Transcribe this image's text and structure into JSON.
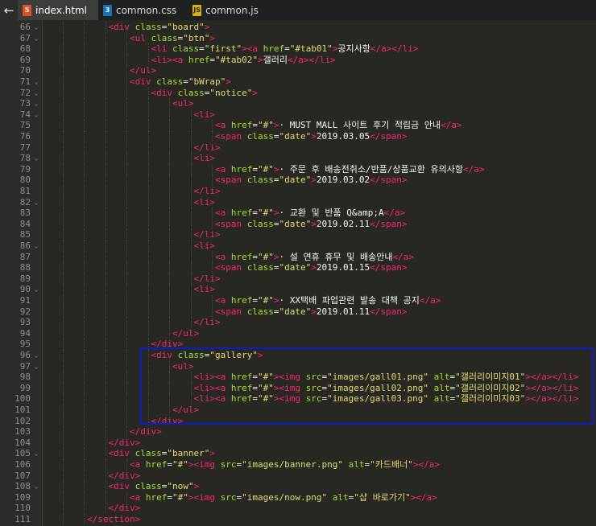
{
  "tabs": [
    {
      "label": "index.html",
      "icon": "html5-icon",
      "badge": "5",
      "color": "#e44d26",
      "active": true
    },
    {
      "label": "common.css",
      "icon": "css3-icon",
      "badge": "3",
      "color": "#1572b6",
      "active": false
    },
    {
      "label": "common.js",
      "icon": "js-icon",
      "badge": "JS",
      "color": "#d6b400",
      "active": false
    }
  ],
  "highlight_color": "#0a1bd6",
  "lines": [
    {
      "n": "66",
      "fold": "⌄",
      "indent": 3,
      "tokens": [
        [
          "tg",
          "<div"
        ],
        [
          "tx",
          " "
        ],
        [
          "at",
          "class"
        ],
        [
          "tx",
          "="
        ],
        [
          "st",
          "\"board\""
        ],
        [
          "tg",
          ">"
        ]
      ]
    },
    {
      "n": "67",
      "fold": "⌄",
      "indent": 4,
      "tokens": [
        [
          "tg",
          "<ul"
        ],
        [
          "tx",
          " "
        ],
        [
          "at",
          "class"
        ],
        [
          "tx",
          "="
        ],
        [
          "st",
          "\"btn\""
        ],
        [
          "tg",
          ">"
        ]
      ]
    },
    {
      "n": "68",
      "fold": "",
      "indent": 5,
      "tokens": [
        [
          "tg",
          "<li"
        ],
        [
          "tx",
          " "
        ],
        [
          "at",
          "class"
        ],
        [
          "tx",
          "="
        ],
        [
          "st",
          "\"first\""
        ],
        [
          "tg",
          ">"
        ],
        [
          "tg",
          "<a"
        ],
        [
          "tx",
          " "
        ],
        [
          "at",
          "href"
        ],
        [
          "tx",
          "="
        ],
        [
          "st",
          "\"#tab01\""
        ],
        [
          "tg",
          ">"
        ],
        [
          "tx",
          "공지사항"
        ],
        [
          "tg",
          "</a>"
        ],
        [
          "tg",
          "</li>"
        ]
      ]
    },
    {
      "n": "69",
      "fold": "",
      "indent": 5,
      "tokens": [
        [
          "tg",
          "<li>"
        ],
        [
          "tg",
          "<a"
        ],
        [
          "tx",
          " "
        ],
        [
          "at",
          "href"
        ],
        [
          "tx",
          "="
        ],
        [
          "st",
          "\"#tab02\""
        ],
        [
          "tg",
          ">"
        ],
        [
          "tx",
          "갤러리"
        ],
        [
          "tg",
          "</a>"
        ],
        [
          "tg",
          "</li>"
        ]
      ]
    },
    {
      "n": "70",
      "fold": "",
      "indent": 4,
      "tokens": [
        [
          "tg",
          "</ul>"
        ]
      ]
    },
    {
      "n": "71",
      "fold": "⌄",
      "indent": 4,
      "tokens": [
        [
          "tg",
          "<div"
        ],
        [
          "tx",
          " "
        ],
        [
          "at",
          "class"
        ],
        [
          "tx",
          "="
        ],
        [
          "st",
          "\"bWrap\""
        ],
        [
          "tg",
          ">"
        ]
      ]
    },
    {
      "n": "72",
      "fold": "⌄",
      "indent": 5,
      "tokens": [
        [
          "tg",
          "<div"
        ],
        [
          "tx",
          " "
        ],
        [
          "at",
          "class"
        ],
        [
          "tx",
          "="
        ],
        [
          "st",
          "\"notice\""
        ],
        [
          "tg",
          ">"
        ]
      ]
    },
    {
      "n": "73",
      "fold": "⌄",
      "indent": 6,
      "tokens": [
        [
          "tg",
          "<ul>"
        ]
      ]
    },
    {
      "n": "74",
      "fold": "⌄",
      "indent": 7,
      "tokens": [
        [
          "tg",
          "<li>"
        ]
      ]
    },
    {
      "n": "75",
      "fold": "",
      "indent": 8,
      "tokens": [
        [
          "tg",
          "<a"
        ],
        [
          "tx",
          " "
        ],
        [
          "at",
          "href"
        ],
        [
          "tx",
          "="
        ],
        [
          "st",
          "\"#\""
        ],
        [
          "tg",
          ">"
        ],
        [
          "tx",
          "· MUST MALL 사이트 후기 적립금 안내"
        ],
        [
          "tg",
          "</a>"
        ]
      ]
    },
    {
      "n": "76",
      "fold": "",
      "indent": 8,
      "tokens": [
        [
          "tg",
          "<span"
        ],
        [
          "tx",
          " "
        ],
        [
          "at",
          "class"
        ],
        [
          "tx",
          "="
        ],
        [
          "st",
          "\"date\""
        ],
        [
          "tg",
          ">"
        ],
        [
          "tx",
          "2019.03.05"
        ],
        [
          "tg",
          "</span>"
        ]
      ]
    },
    {
      "n": "77",
      "fold": "",
      "indent": 7,
      "tokens": [
        [
          "tg",
          "</li>"
        ]
      ]
    },
    {
      "n": "78",
      "fold": "⌄",
      "indent": 7,
      "tokens": [
        [
          "tg",
          "<li>"
        ]
      ]
    },
    {
      "n": "79",
      "fold": "",
      "indent": 8,
      "tokens": [
        [
          "tg",
          "<a"
        ],
        [
          "tx",
          " "
        ],
        [
          "at",
          "href"
        ],
        [
          "tx",
          "="
        ],
        [
          "st",
          "\"#\""
        ],
        [
          "tg",
          ">"
        ],
        [
          "tx",
          "· 주문 후 배송전취소/반품/상품교환 유의사항"
        ],
        [
          "tg",
          "</a>"
        ]
      ]
    },
    {
      "n": "80",
      "fold": "",
      "indent": 8,
      "tokens": [
        [
          "tg",
          "<span"
        ],
        [
          "tx",
          " "
        ],
        [
          "at",
          "class"
        ],
        [
          "tx",
          "="
        ],
        [
          "st",
          "\"date\""
        ],
        [
          "tg",
          ">"
        ],
        [
          "tx",
          "2019.03.02"
        ],
        [
          "tg",
          "</span>"
        ]
      ]
    },
    {
      "n": "81",
      "fold": "",
      "indent": 7,
      "tokens": [
        [
          "tg",
          "</li>"
        ]
      ]
    },
    {
      "n": "82",
      "fold": "⌄",
      "indent": 7,
      "tokens": [
        [
          "tg",
          "<li>"
        ]
      ]
    },
    {
      "n": "83",
      "fold": "",
      "indent": 8,
      "tokens": [
        [
          "tg",
          "<a"
        ],
        [
          "tx",
          " "
        ],
        [
          "at",
          "href"
        ],
        [
          "tx",
          "="
        ],
        [
          "st",
          "\"#\""
        ],
        [
          "tg",
          ">"
        ],
        [
          "tx",
          "· 교환 및 반품 Q&amp;A"
        ],
        [
          "tg",
          "</a>"
        ]
      ]
    },
    {
      "n": "84",
      "fold": "",
      "indent": 8,
      "tokens": [
        [
          "tg",
          "<span"
        ],
        [
          "tx",
          " "
        ],
        [
          "at",
          "class"
        ],
        [
          "tx",
          "="
        ],
        [
          "st",
          "\"date\""
        ],
        [
          "tg",
          ">"
        ],
        [
          "tx",
          "2019.02.11"
        ],
        [
          "tg",
          "</span>"
        ]
      ]
    },
    {
      "n": "85",
      "fold": "",
      "indent": 7,
      "tokens": [
        [
          "tg",
          "</li>"
        ]
      ]
    },
    {
      "n": "86",
      "fold": "⌄",
      "indent": 7,
      "tokens": [
        [
          "tg",
          "<li>"
        ]
      ]
    },
    {
      "n": "87",
      "fold": "",
      "indent": 8,
      "tokens": [
        [
          "tg",
          "<a"
        ],
        [
          "tx",
          " "
        ],
        [
          "at",
          "href"
        ],
        [
          "tx",
          "="
        ],
        [
          "st",
          "\"#\""
        ],
        [
          "tg",
          ">"
        ],
        [
          "tx",
          "· 설 연휴 휴무 및 배송안내"
        ],
        [
          "tg",
          "</a>"
        ]
      ]
    },
    {
      "n": "88",
      "fold": "",
      "indent": 8,
      "tokens": [
        [
          "tg",
          "<span"
        ],
        [
          "tx",
          " "
        ],
        [
          "at",
          "class"
        ],
        [
          "tx",
          "="
        ],
        [
          "st",
          "\"date\""
        ],
        [
          "tg",
          ">"
        ],
        [
          "tx",
          "2019.01.15"
        ],
        [
          "tg",
          "</span>"
        ]
      ]
    },
    {
      "n": "89",
      "fold": "",
      "indent": 7,
      "tokens": [
        [
          "tg",
          "</li>"
        ]
      ]
    },
    {
      "n": "90",
      "fold": "⌄",
      "indent": 7,
      "tokens": [
        [
          "tg",
          "<li>"
        ]
      ]
    },
    {
      "n": "91",
      "fold": "",
      "indent": 8,
      "tokens": [
        [
          "tg",
          "<a"
        ],
        [
          "tx",
          " "
        ],
        [
          "at",
          "href"
        ],
        [
          "tx",
          "="
        ],
        [
          "st",
          "\"#\""
        ],
        [
          "tg",
          ">"
        ],
        [
          "tx",
          "· XX택배 파업관련 발송 대책 공지"
        ],
        [
          "tg",
          "</a>"
        ]
      ]
    },
    {
      "n": "92",
      "fold": "",
      "indent": 8,
      "tokens": [
        [
          "tg",
          "<span"
        ],
        [
          "tx",
          " "
        ],
        [
          "at",
          "class"
        ],
        [
          "tx",
          "="
        ],
        [
          "st",
          "\"date\""
        ],
        [
          "tg",
          ">"
        ],
        [
          "tx",
          "2019.01.11"
        ],
        [
          "tg",
          "</span>"
        ]
      ]
    },
    {
      "n": "93",
      "fold": "",
      "indent": 7,
      "tokens": [
        [
          "tg",
          "</li>"
        ]
      ]
    },
    {
      "n": "94",
      "fold": "",
      "indent": 6,
      "tokens": [
        [
          "tg",
          "</ul>"
        ]
      ]
    },
    {
      "n": "95",
      "fold": "",
      "indent": 5,
      "tokens": [
        [
          "tg",
          "</div>"
        ]
      ]
    },
    {
      "n": "96",
      "fold": "⌄",
      "indent": 5,
      "tokens": [
        [
          "tg",
          "<div"
        ],
        [
          "tx",
          " "
        ],
        [
          "at",
          "class"
        ],
        [
          "tx",
          "="
        ],
        [
          "st",
          "\"gallery\""
        ],
        [
          "tg",
          ">"
        ]
      ]
    },
    {
      "n": "97",
      "fold": "⌄",
      "indent": 6,
      "tokens": [
        [
          "tg",
          "<ul>"
        ]
      ]
    },
    {
      "n": "98",
      "fold": "",
      "indent": 7,
      "tokens": [
        [
          "tg",
          "<li>"
        ],
        [
          "tg",
          "<a"
        ],
        [
          "tx",
          " "
        ],
        [
          "at",
          "href"
        ],
        [
          "tx",
          "="
        ],
        [
          "st",
          "\"#\""
        ],
        [
          "tg",
          ">"
        ],
        [
          "tg",
          "<img"
        ],
        [
          "tx",
          " "
        ],
        [
          "at",
          "src"
        ],
        [
          "tx",
          "="
        ],
        [
          "st",
          "\"images/gall01.png\""
        ],
        [
          "tx",
          " "
        ],
        [
          "at",
          "alt"
        ],
        [
          "tx",
          "="
        ],
        [
          "st",
          "\"갤러리이미지01\""
        ],
        [
          "tg",
          ">"
        ],
        [
          "tg",
          "</a>"
        ],
        [
          "tg",
          "</li>"
        ]
      ]
    },
    {
      "n": "99",
      "fold": "",
      "indent": 7,
      "tokens": [
        [
          "tg",
          "<li>"
        ],
        [
          "tg",
          "<a"
        ],
        [
          "tx",
          " "
        ],
        [
          "at",
          "href"
        ],
        [
          "tx",
          "="
        ],
        [
          "st",
          "\"#\""
        ],
        [
          "tg",
          ">"
        ],
        [
          "tg",
          "<img"
        ],
        [
          "tx",
          " "
        ],
        [
          "at",
          "src"
        ],
        [
          "tx",
          "="
        ],
        [
          "st",
          "\"images/gall02.png\""
        ],
        [
          "tx",
          " "
        ],
        [
          "at",
          "alt"
        ],
        [
          "tx",
          "="
        ],
        [
          "st",
          "\"갤러리이미지02\""
        ],
        [
          "tg",
          ">"
        ],
        [
          "tg",
          "</a>"
        ],
        [
          "tg",
          "</li>"
        ]
      ]
    },
    {
      "n": "100",
      "fold": "",
      "indent": 7,
      "tokens": [
        [
          "tg",
          "<li>"
        ],
        [
          "tg",
          "<a"
        ],
        [
          "tx",
          " "
        ],
        [
          "at",
          "href"
        ],
        [
          "tx",
          "="
        ],
        [
          "st",
          "\"#\""
        ],
        [
          "tg",
          ">"
        ],
        [
          "tg",
          "<img"
        ],
        [
          "tx",
          " "
        ],
        [
          "at",
          "src"
        ],
        [
          "tx",
          "="
        ],
        [
          "st",
          "\"images/gall03.png\""
        ],
        [
          "tx",
          " "
        ],
        [
          "at",
          "alt"
        ],
        [
          "tx",
          "="
        ],
        [
          "st",
          "\"갤러리이미지03\""
        ],
        [
          "tg",
          ">"
        ],
        [
          "tg",
          "</a>"
        ],
        [
          "tg",
          "</li>"
        ]
      ]
    },
    {
      "n": "101",
      "fold": "",
      "indent": 6,
      "tokens": [
        [
          "tg",
          "</ul>"
        ]
      ]
    },
    {
      "n": "102",
      "fold": "",
      "indent": 5,
      "tokens": [
        [
          "tg",
          "</div>"
        ]
      ]
    },
    {
      "n": "103",
      "fold": "",
      "indent": 4,
      "tokens": [
        [
          "tg",
          "</div>"
        ]
      ]
    },
    {
      "n": "104",
      "fold": "",
      "indent": 3,
      "tokens": [
        [
          "tg",
          "</div>"
        ]
      ]
    },
    {
      "n": "105",
      "fold": "⌄",
      "indent": 3,
      "tokens": [
        [
          "tg",
          "<div"
        ],
        [
          "tx",
          " "
        ],
        [
          "at",
          "class"
        ],
        [
          "tx",
          "="
        ],
        [
          "st",
          "\"banner\""
        ],
        [
          "tg",
          ">"
        ]
      ]
    },
    {
      "n": "106",
      "fold": "",
      "indent": 4,
      "tokens": [
        [
          "tg",
          "<a"
        ],
        [
          "tx",
          " "
        ],
        [
          "at",
          "href"
        ],
        [
          "tx",
          "="
        ],
        [
          "st",
          "\"#\""
        ],
        [
          "tg",
          ">"
        ],
        [
          "tg",
          "<img"
        ],
        [
          "tx",
          " "
        ],
        [
          "at",
          "src"
        ],
        [
          "tx",
          "="
        ],
        [
          "st",
          "\"images/banner.png\""
        ],
        [
          "tx",
          " "
        ],
        [
          "at",
          "alt"
        ],
        [
          "tx",
          "="
        ],
        [
          "st",
          "\"카드배너\""
        ],
        [
          "tg",
          ">"
        ],
        [
          "tg",
          "</a>"
        ]
      ]
    },
    {
      "n": "107",
      "fold": "",
      "indent": 3,
      "tokens": [
        [
          "tg",
          "</div>"
        ]
      ]
    },
    {
      "n": "108",
      "fold": "⌄",
      "indent": 3,
      "tokens": [
        [
          "tg",
          "<div"
        ],
        [
          "tx",
          " "
        ],
        [
          "at",
          "class"
        ],
        [
          "tx",
          "="
        ],
        [
          "st",
          "\"now\""
        ],
        [
          "tg",
          ">"
        ]
      ]
    },
    {
      "n": "109",
      "fold": "",
      "indent": 4,
      "tokens": [
        [
          "tg",
          "<a"
        ],
        [
          "tx",
          " "
        ],
        [
          "at",
          "href"
        ],
        [
          "tx",
          "="
        ],
        [
          "st",
          "\"#\""
        ],
        [
          "tg",
          ">"
        ],
        [
          "tg",
          "<img"
        ],
        [
          "tx",
          " "
        ],
        [
          "at",
          "src"
        ],
        [
          "tx",
          "="
        ],
        [
          "st",
          "\"images/now.png\""
        ],
        [
          "tx",
          " "
        ],
        [
          "at",
          "alt"
        ],
        [
          "tx",
          "="
        ],
        [
          "st",
          "\"샵 바로가기\""
        ],
        [
          "tg",
          ">"
        ],
        [
          "tg",
          "</a>"
        ]
      ]
    },
    {
      "n": "110",
      "fold": "",
      "indent": 3,
      "tokens": [
        [
          "tg",
          "</div>"
        ]
      ]
    },
    {
      "n": "111",
      "fold": "",
      "indent": 2,
      "tokens": [
        [
          "tg",
          "</section>"
        ]
      ]
    }
  ]
}
